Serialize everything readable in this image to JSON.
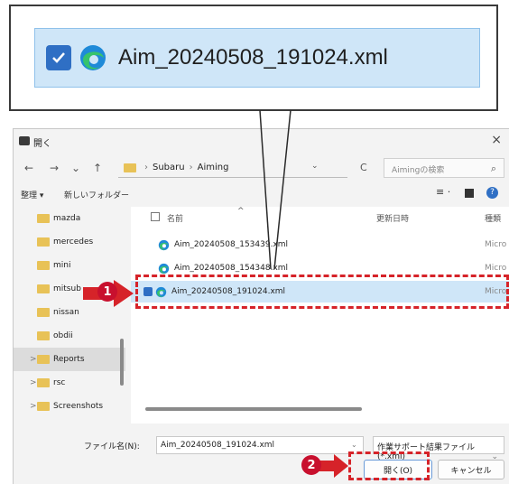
{
  "callout": {
    "filename": "Aim_20240508_191024.xml"
  },
  "dialog": {
    "title": "開く",
    "close": "×",
    "nav": {
      "back": "←",
      "forward": "→",
      "recent": "⌄",
      "up": "↑"
    },
    "breadcrumb": [
      "Subaru",
      "Aiming"
    ],
    "refresh": "C",
    "search_placeholder": "Aimingの検索",
    "commands": {
      "organize": "整理 ▾",
      "new_folder": "新しいフォルダー"
    },
    "sidebar": [
      {
        "label": "mazda",
        "expander": ""
      },
      {
        "label": "mercedes",
        "expander": ""
      },
      {
        "label": "mini",
        "expander": ""
      },
      {
        "label": "mitsub",
        "expander": ""
      },
      {
        "label": "nissan",
        "expander": ""
      },
      {
        "label": "obdii",
        "expander": ""
      },
      {
        "label": "Reports",
        "expander": ">"
      },
      {
        "label": "rsc",
        "expander": ">"
      },
      {
        "label": "Screenshots",
        "expander": ">"
      }
    ],
    "columns": {
      "name": "名前",
      "modified": "更新日時",
      "type": "種類"
    },
    "files": [
      {
        "name": "Aim_20240508_153439.xml",
        "type": "Micro"
      },
      {
        "name": "Aim_20240508_154348.xml",
        "type": "Micro"
      },
      {
        "name": "Aim_20240508_191024.xml",
        "type": "Micro"
      }
    ],
    "filename_label": "ファイル名(N):",
    "filename_value": "Aim_20240508_191024.xml",
    "filetype": "作業サポート結果ファイル (*.xml)",
    "open_button": "開く(O)",
    "cancel_button": "キャンセル"
  },
  "annotations": {
    "step1": "1",
    "step2": "2"
  },
  "colors": {
    "accent": "#2f6fc4",
    "selection": "#cfe6f8",
    "annotation": "#d62329"
  }
}
